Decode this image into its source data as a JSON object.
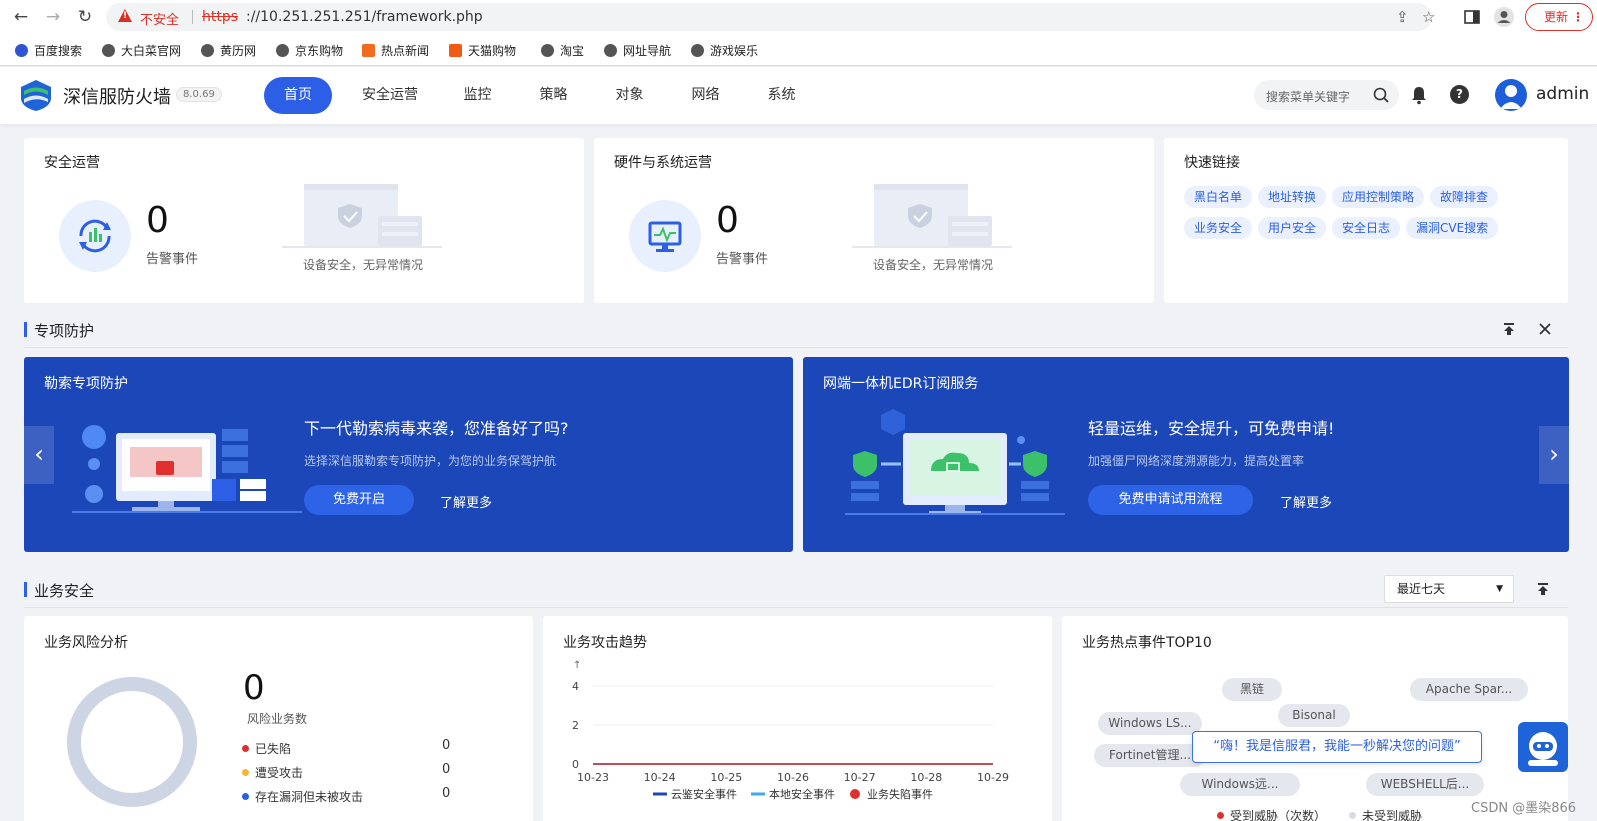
{
  "browser": {
    "insecure_label": "不安全",
    "url_scheme": "https",
    "url_rest": "://10.251.251.251/framework.php",
    "update_label": "更新",
    "bookmarks": [
      "百度搜索",
      "大白菜官网",
      "黄历网",
      "京东购物",
      "热点新闻",
      "天猫购物",
      "淘宝",
      "网址导航",
      "游戏娱乐"
    ]
  },
  "header": {
    "brand": "深信服防火墙",
    "version": "8.0.69",
    "nav": [
      "首页",
      "安全运营",
      "监控",
      "策略",
      "对象",
      "网络",
      "系统"
    ],
    "search_placeholder": "搜索菜单关键字",
    "user": "admin"
  },
  "sec_ops": {
    "title": "安全运营",
    "count": "0",
    "count_label": "告警事件",
    "empty_text": "设备安全，无异常情况"
  },
  "hw_ops": {
    "title": "硬件与系统运营",
    "count": "0",
    "count_label": "告警事件",
    "empty_text": "设备安全，无异常情况"
  },
  "quick_links": {
    "title": "快速链接",
    "row1": [
      "黑白名单",
      "地址转换",
      "应用控制策略",
      "故障排查"
    ],
    "row2": [
      "业务安全",
      "用户安全",
      "安全日志",
      "漏洞CVE搜索"
    ]
  },
  "special": {
    "title": "专项防护",
    "banners": [
      {
        "title": "勒索专项防护",
        "headline": "下一代勒索病毒来袭，您准备好了吗?",
        "desc": "选择深信服勒索专项防护，为您的业务保驾护航",
        "button": "免费开启",
        "link": "了解更多"
      },
      {
        "title": "网端一体机EDR订阅服务",
        "headline": "轻量运维，安全提升，可免费申请!",
        "desc": "加强僵尸网络深度溯源能力，提高处置率",
        "button": "免费申请试用流程",
        "link": "了解更多"
      }
    ]
  },
  "biz": {
    "title": "业务安全",
    "range": "最近七天",
    "risk": {
      "title": "业务风险分析",
      "count": "0",
      "count_label": "风险业务数",
      "rows": [
        {
          "label": "已失陷",
          "value": "0",
          "color": "#e0302d"
        },
        {
          "label": "遭受攻击",
          "value": "0",
          "color": "#f5b731"
        },
        {
          "label": "存在漏洞但未被攻击",
          "value": "0",
          "color": "#2c5fe6"
        }
      ]
    },
    "trend": {
      "title": "业务攻击趋势"
    },
    "hot": {
      "title": "业务热点事件TOP10",
      "pills": [
        "黑链",
        "Apache Spar...",
        "Bisonal",
        "Windows LS...",
        "Fortinet管理...",
        "Windows远...",
        "WEBSHELL后..."
      ],
      "legend": [
        "受到威胁（次数）",
        "未受到威胁"
      ]
    }
  },
  "chart_data": {
    "type": "line",
    "title": "业务攻击趋势",
    "x": [
      "10-23",
      "10-24",
      "10-25",
      "10-26",
      "10-27",
      "10-28",
      "10-29"
    ],
    "yticks": [
      "0",
      "2",
      "4"
    ],
    "ylim": [
      0,
      4
    ],
    "series": [
      {
        "name": "云鉴安全事件",
        "values": [
          0,
          0,
          0,
          0,
          0,
          0,
          0
        ],
        "color": "#1c47b8"
      },
      {
        "name": "本地安全事件",
        "values": [
          0,
          0,
          0,
          0,
          0,
          0,
          0
        ],
        "color": "#3fa8f0"
      },
      {
        "name": "业务失陷事件",
        "values": [
          0,
          0,
          0,
          0,
          0,
          0,
          0
        ],
        "color": "#e0302d"
      }
    ]
  },
  "bot": {
    "bubble": "“嗨！我是信服君，我能一秒解决您的问题”"
  },
  "watermark": "CSDN @墨染866"
}
